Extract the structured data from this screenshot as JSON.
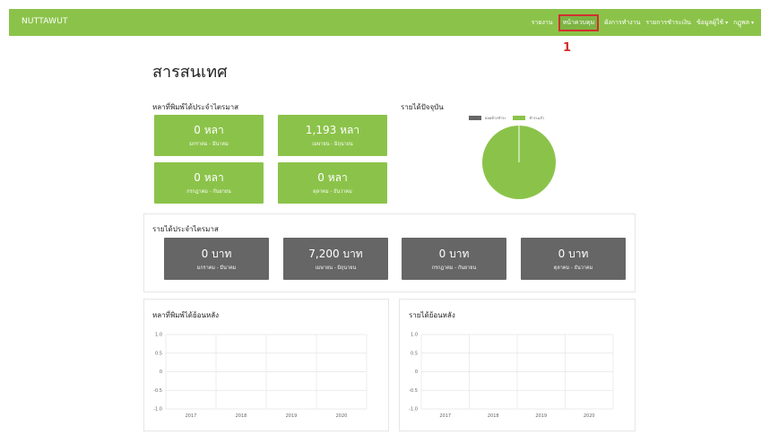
{
  "navbar": {
    "brand": "NUTTAWUT",
    "menu": [
      {
        "label": "รายงาน"
      },
      {
        "label": "หน้าควบคุม",
        "active": true
      },
      {
        "label": "ผังการทำงาน"
      },
      {
        "label": "รายการชำระเงิน"
      },
      {
        "label": "ข้อมูลผู้ใช้",
        "caret": true
      },
      {
        "label": "กฏูพล",
        "caret": true
      }
    ]
  },
  "annotation": "1",
  "page_title": "สารสนเทศ",
  "printed_quarterly": {
    "title": "หลาที่พิมพ์ได้ประจำไตรมาส",
    "cards": [
      {
        "value": "0 หลา",
        "range": "มกราคม - มีนาคม"
      },
      {
        "value": "1,193 หลา",
        "range": "เมษายน - มิถุนายน"
      },
      {
        "value": "0 หลา",
        "range": "กรกฎาคม - กันยายน"
      },
      {
        "value": "0 หลา",
        "range": "ตุลาคม - ธันวาคม"
      }
    ]
  },
  "current_income": {
    "title": "รายได้ปัจจุบัน",
    "legend": [
      {
        "label": "ยอดค้างชำระ",
        "color": "#666666"
      },
      {
        "label": "ชำระแล้ว",
        "color": "#8bc34a"
      }
    ]
  },
  "income_quarterly": {
    "title": "รายได้ประจำไตรมาส",
    "cards": [
      {
        "value": "0 บาท",
        "range": "มกราคม - มีนาคม"
      },
      {
        "value": "7,200 บาท",
        "range": "เมษายน - มิถุนายน"
      },
      {
        "value": "0 บาท",
        "range": "กรกฎาคม - กันยายน"
      },
      {
        "value": "0 บาท",
        "range": "ตุลาคม - ธันวาคม"
      }
    ]
  },
  "printed_history": {
    "title": "หลาที่พิมพ์ได้ย้อนหลัง"
  },
  "income_history": {
    "title": "รายได้ย้อนหลัง"
  },
  "chart_data": [
    {
      "type": "pie",
      "title": "รายได้ปัจจุบัน",
      "categories": [
        "ยอดค้างชำระ",
        "ชำระแล้ว"
      ],
      "values": [
        0,
        100
      ],
      "colors": [
        "#666666",
        "#8bc34a"
      ],
      "legend": "top"
    },
    {
      "type": "line",
      "title": "หลาที่พิมพ์ได้ย้อนหลัง",
      "x": [
        "2017",
        "2018",
        "2019",
        "2020"
      ],
      "yticks": [
        "1.0",
        "0.5",
        "0",
        "-0.5",
        "-1.0"
      ],
      "ylim": [
        -1,
        1
      ],
      "series": [],
      "grid": true
    },
    {
      "type": "line",
      "title": "รายได้ย้อนหลัง",
      "x": [
        "2017",
        "2018",
        "2019",
        "2020"
      ],
      "yticks": [
        "1.0",
        "0.5",
        "0",
        "-0.5",
        "-1.0"
      ],
      "ylim": [
        -1,
        1
      ],
      "series": [],
      "grid": true
    }
  ]
}
